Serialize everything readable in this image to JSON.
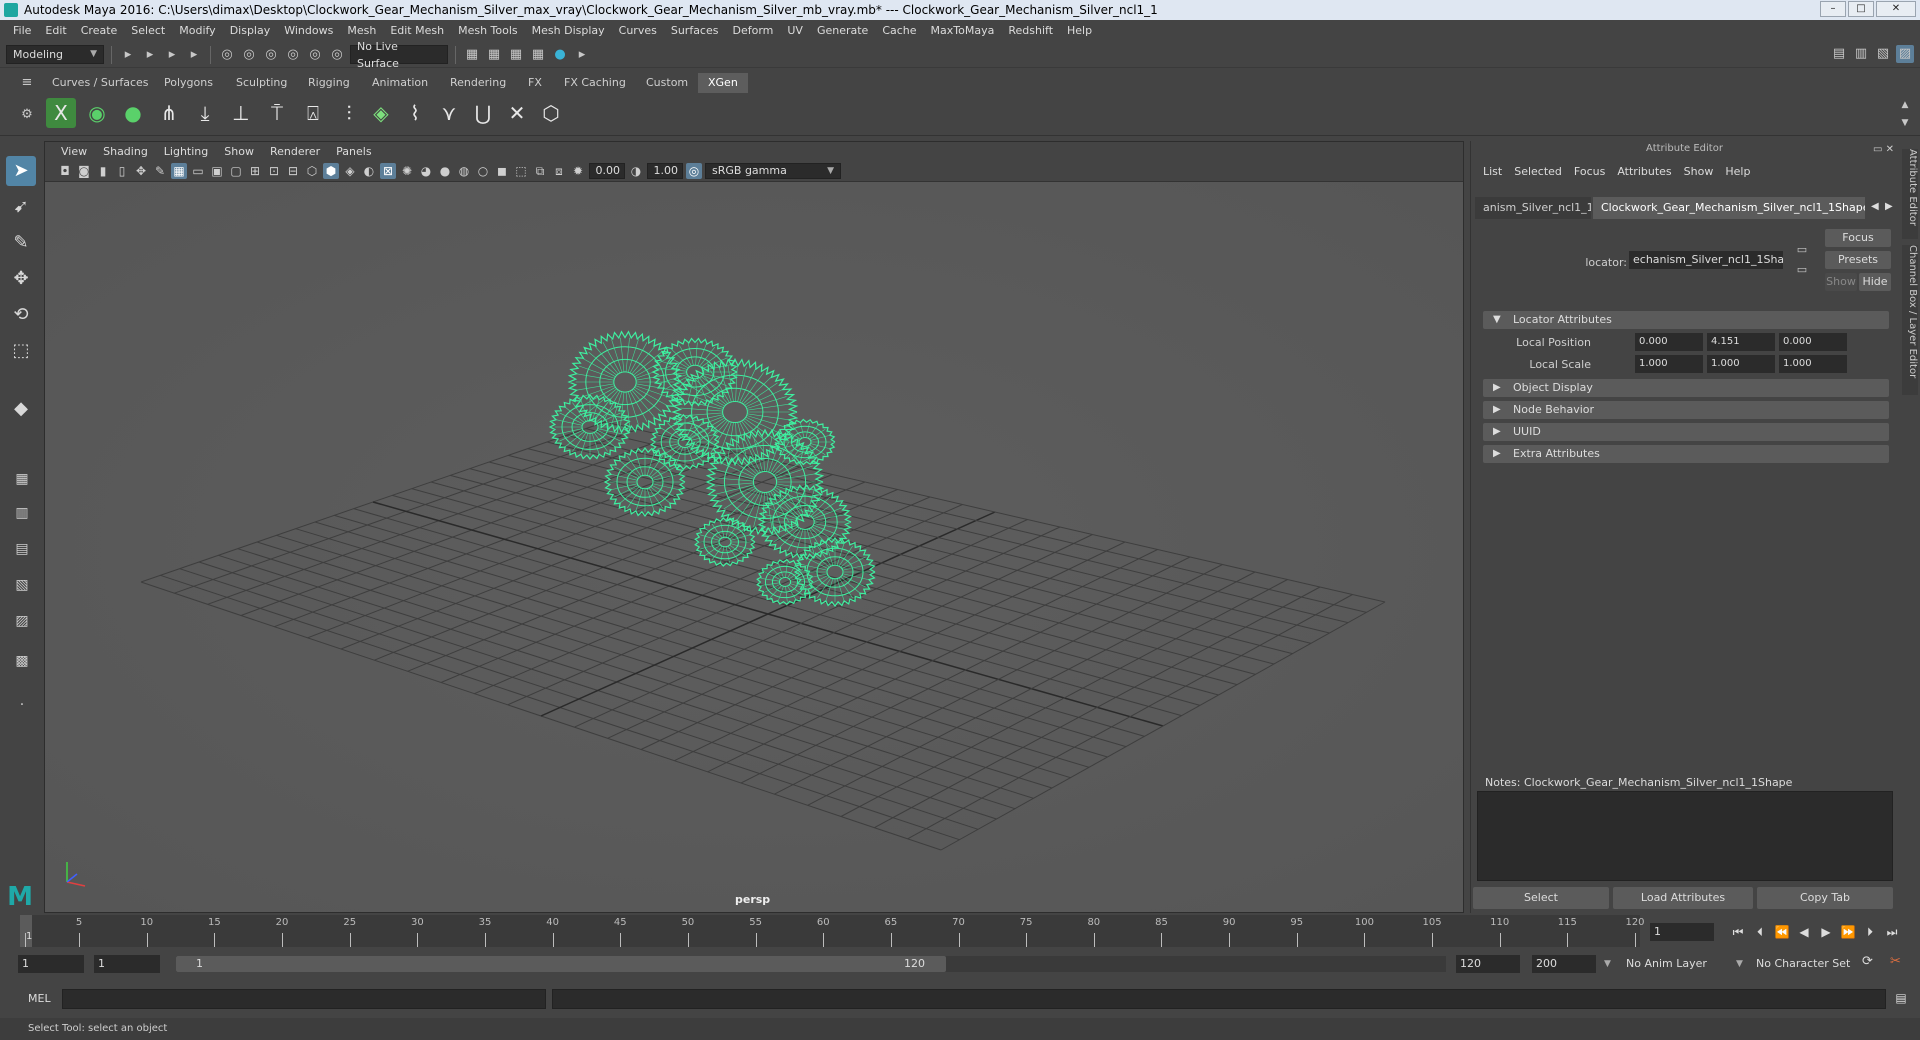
{
  "window": {
    "title": "Autodesk Maya 2016: C:\\Users\\dimax\\Desktop\\Clockwork_Gear_Mechanism_Silver_max_vray\\Clockwork_Gear_Mechanism_Silver_mb_vray.mb*   ---   Clockwork_Gear_Mechanism_Silver_ncl1_1",
    "buttons": [
      "–",
      "□",
      "✕"
    ]
  },
  "menubar": [
    "File",
    "Edit",
    "Create",
    "Select",
    "Modify",
    "Display",
    "Windows",
    "Mesh",
    "Edit Mesh",
    "Mesh Tools",
    "Mesh Display",
    "Curves",
    "Surfaces",
    "Deform",
    "UV",
    "Generate",
    "Cache",
    "MaxToMaya",
    "Redshift",
    "Help"
  ],
  "statusline": {
    "mode": "Modeling",
    "live_surface": "No Live Surface"
  },
  "shelf_tabs": [
    "Curves / Surfaces",
    "Polygons",
    "Sculpting",
    "Rigging",
    "Animation",
    "Rendering",
    "FX",
    "FX Caching",
    "Custom",
    "XGen"
  ],
  "shelf_active_tab": "XGen",
  "viewport": {
    "menus": [
      "View",
      "Shading",
      "Lighting",
      "Show",
      "Renderer",
      "Panels"
    ],
    "exposure": "0.00",
    "gamma": "1.00",
    "color_space": "sRGB gamma",
    "camera": "persp",
    "wireframe_color": "#3ef0a0"
  },
  "attribute_editor": {
    "title": "Attribute Editor",
    "menus": [
      "List",
      "Selected",
      "Focus",
      "Attributes",
      "Show",
      "Help"
    ],
    "tabs": [
      "anism_Silver_ncl1_1",
      "Clockwork_Gear_Mechanism_Silver_ncl1_1Shape"
    ],
    "node_type": "locator:",
    "node_name": "echanism_Silver_ncl1_1Shape",
    "buttons": {
      "focus": "Focus",
      "presets": "Presets",
      "show": "Show",
      "hide": "Hide"
    },
    "sections": {
      "locator": "Locator Attributes",
      "object_display": "Object Display",
      "node_behavior": "Node Behavior",
      "uuid": "UUID",
      "extra": "Extra Attributes"
    },
    "local_position": {
      "label": "Local Position",
      "x": "0.000",
      "y": "4.151",
      "z": "0.000"
    },
    "local_scale": {
      "label": "Local Scale",
      "x": "1.000",
      "y": "1.000",
      "z": "1.000"
    },
    "notes": "Notes:  Clockwork_Gear_Mechanism_Silver_ncl1_1Shape",
    "bottom_buttons": {
      "select": "Select",
      "load": "Load Attributes",
      "copy": "Copy Tab"
    },
    "side_tabs": [
      "Attribute Editor",
      "Channel Box / Layer Editor"
    ]
  },
  "timeline": {
    "ticks": [
      1,
      5,
      10,
      15,
      20,
      25,
      30,
      35,
      40,
      45,
      50,
      55,
      60,
      65,
      70,
      75,
      80,
      85,
      90,
      95,
      100,
      105,
      110,
      115,
      120
    ],
    "current_frame": "1",
    "playhead_label": "1"
  },
  "range": {
    "start": "1",
    "start_inner": "1",
    "range_start_label": "1",
    "range_end_label": "120",
    "end_inner": "120",
    "end": "200",
    "anim_layer": "No Anim Layer",
    "character_set": "No Character Set"
  },
  "cmdline": {
    "label": "MEL"
  },
  "helpline": "Select Tool: select an object"
}
